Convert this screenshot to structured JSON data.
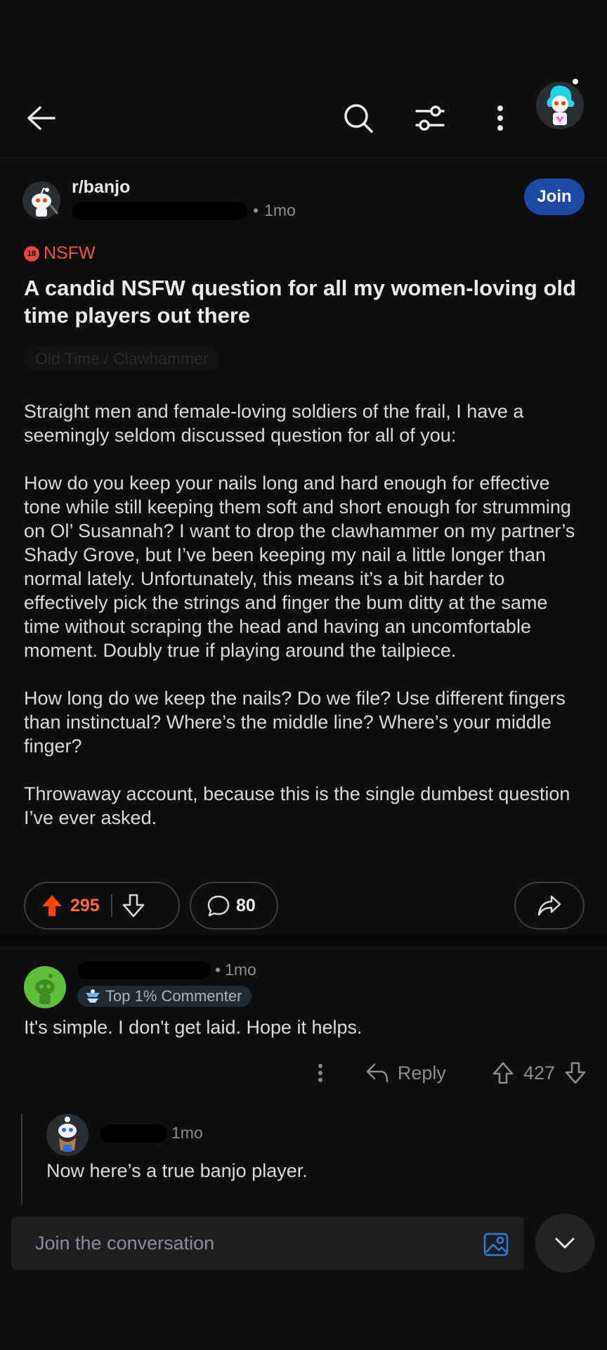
{
  "topbar": {
    "icons": [
      "arrow-left-icon",
      "search-icon",
      "filter-icon",
      "more-vertical-icon"
    ],
    "avatar": "user-avatar"
  },
  "post": {
    "subreddit": "r/banjo",
    "author": "",
    "age": "1mo",
    "join_label": "Join",
    "nsfw_badge": "18",
    "nsfw_label": "NSFW",
    "title": "A candid NSFW question for all my women-loving old time players out there",
    "flair": "Old Time / Clawhammer",
    "body": [
      "Straight men and female-loving soldiers of the frail, I have a seemingly seldom discussed question for all of you:",
      "How do you keep your nails long and hard enough for effective tone while still keeping them soft and short enough for strumming on Ol’ Susannah? I want to drop the clawhammer on my partner’s Shady Grove, but I’ve been keeping my nail a little longer than normal lately. Unfortunately, this means it’s a bit harder to effectively pick the strings and finger the bum ditty at the same time without scraping the head and having an uncomfortable moment. Doubly true if playing around the tailpiece.",
      "How long do we keep the nails? Do we file? Use different fingers than instinctual? Where’s the middle line? Where’s your middle finger?",
      "Throwaway account, because this is the single dumbest question I’ve ever asked."
    ],
    "upvotes": "295",
    "comments": "80",
    "colors": {
      "upvote_active": "#ff4500",
      "join": "#1d4aa5",
      "nsfw": "#f2524b"
    }
  },
  "comments": [
    {
      "age": "1mo",
      "badge": "Top 1% Commenter",
      "text": "It's simple. I don't get laid. Hope it helps.",
      "reply_label": "Reply",
      "score": "427"
    },
    {
      "age": "1mo",
      "text": "Now here’s a true banjo player."
    }
  ],
  "composer": {
    "placeholder": "Join the conversation"
  }
}
